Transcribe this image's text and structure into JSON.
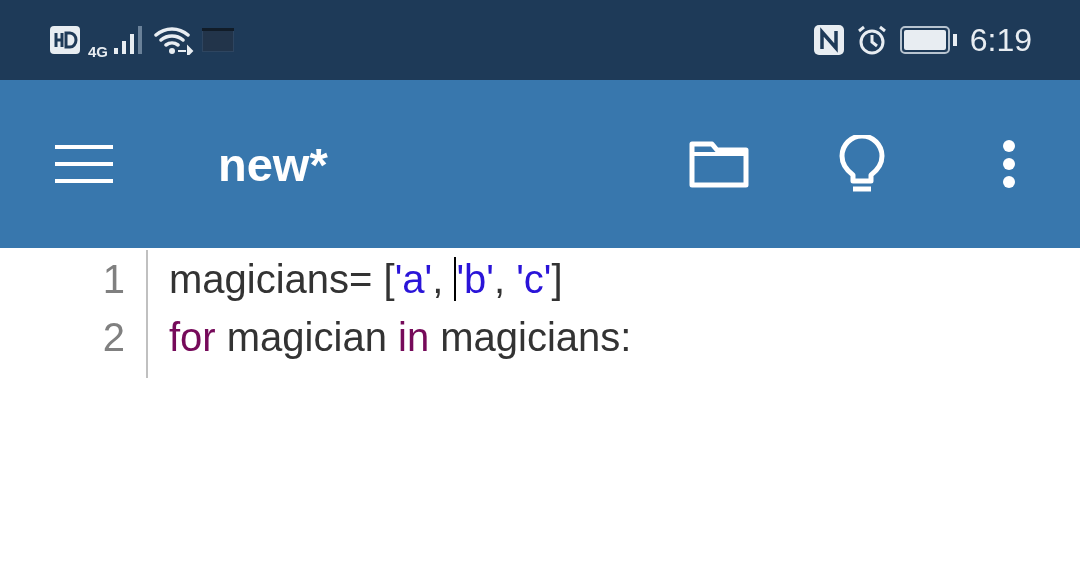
{
  "status_bar": {
    "network": "4G",
    "time": "6:19"
  },
  "app_bar": {
    "title": "new*"
  },
  "editor": {
    "lines": [
      {
        "number": "1",
        "tokens": [
          {
            "text": "magicians= [",
            "kind": "plain",
            "cursor": false
          },
          {
            "text": "'a'",
            "kind": "string",
            "cursor": false
          },
          {
            "text": ", ",
            "kind": "plain",
            "cursor": false
          },
          {
            "text": "'b'",
            "kind": "string",
            "cursor": true
          },
          {
            "text": ", ",
            "kind": "plain",
            "cursor": false
          },
          {
            "text": "'c'",
            "kind": "string",
            "cursor": false
          },
          {
            "text": "]",
            "kind": "plain",
            "cursor": false
          }
        ]
      },
      {
        "number": "2",
        "tokens": [
          {
            "text": "for",
            "kind": "keyword",
            "cursor": false
          },
          {
            "text": " magician ",
            "kind": "plain",
            "cursor": false
          },
          {
            "text": "in",
            "kind": "keyword",
            "cursor": false
          },
          {
            "text": " magicians:",
            "kind": "plain",
            "cursor": false
          }
        ]
      }
    ]
  }
}
